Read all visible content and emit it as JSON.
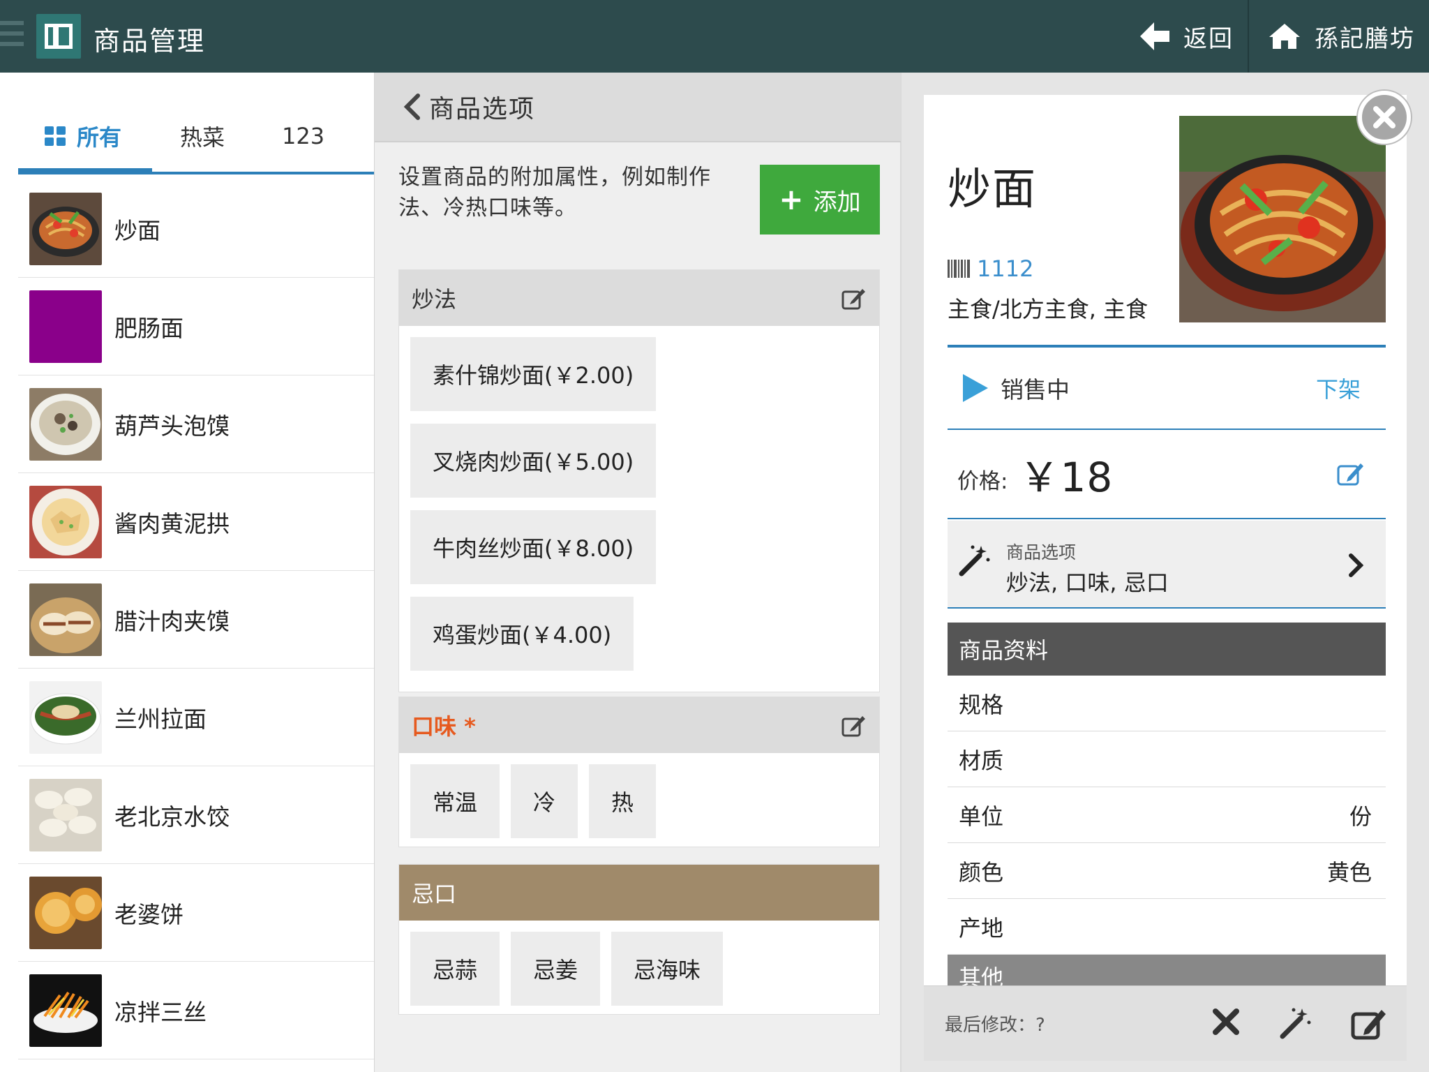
{
  "topbar": {
    "title": "商品管理",
    "back_label": "返回",
    "store_name": "孫記膳坊"
  },
  "left": {
    "tabs": [
      {
        "label": "所有",
        "active": true,
        "icon": "grid-icon"
      },
      {
        "label": "热菜",
        "active": false
      },
      {
        "label": "123",
        "active": false
      }
    ],
    "items": [
      {
        "name": "炒面",
        "thumb": "noodle-plate"
      },
      {
        "name": "肥肠面",
        "thumb": "purple-swatch"
      },
      {
        "name": "葫芦头泡馍",
        "thumb": "soup-bowl"
      },
      {
        "name": "酱肉黄泥拱",
        "thumb": "plated-dish"
      },
      {
        "name": "腊汁肉夹馍",
        "thumb": "bun-basket"
      },
      {
        "name": "兰州拉面",
        "thumb": "noodle-soup"
      },
      {
        "name": "老北京水饺",
        "thumb": "dumplings"
      },
      {
        "name": "老婆饼",
        "thumb": "pastry"
      },
      {
        "name": "凉拌三丝",
        "thumb": "shredded-salad"
      }
    ]
  },
  "middle": {
    "title": "商品选项",
    "description": "设置商品的附加属性，例如制作法、冷热口味等。",
    "add_label": "添加",
    "groups": [
      {
        "title": "炒法",
        "required": false,
        "style": "gray",
        "options": [
          "素什锦炒面(￥2.00)",
          "叉烧肉炒面(￥5.00)",
          "牛肉丝炒面(￥8.00)",
          "鸡蛋炒面(￥4.00)"
        ]
      },
      {
        "title": "口味",
        "required": true,
        "required_mark": "*",
        "style": "gray",
        "options": [
          "常温",
          "冷",
          "热"
        ]
      },
      {
        "title": "忌口",
        "required": false,
        "style": "brown",
        "options": [
          "忌蒜",
          "忌姜",
          "忌海味"
        ]
      }
    ]
  },
  "right": {
    "name": "炒面",
    "barcode": "1112",
    "category": "主食/北方主食, 主食",
    "status": "销售中",
    "offshelf_label": "下架",
    "price_label": "价格:",
    "price": "￥18",
    "options_label": "商品选项",
    "options_value": "炒法, 口味, 忌口",
    "info_title": "商品资料",
    "info_rows": [
      {
        "label": "规格",
        "value": ""
      },
      {
        "label": "材质",
        "value": ""
      },
      {
        "label": "单位",
        "value": "份"
      },
      {
        "label": "颜色",
        "value": "黄色"
      },
      {
        "label": "产地",
        "value": ""
      }
    ],
    "other_title": "其他",
    "last_modified": "最后修改：?",
    "colors": {
      "accent": "#2c7fb8",
      "green": "#3fa93d",
      "required": "#e65a1f",
      "brown": "#a08a6a",
      "topbar": "#2d4b4d"
    }
  }
}
